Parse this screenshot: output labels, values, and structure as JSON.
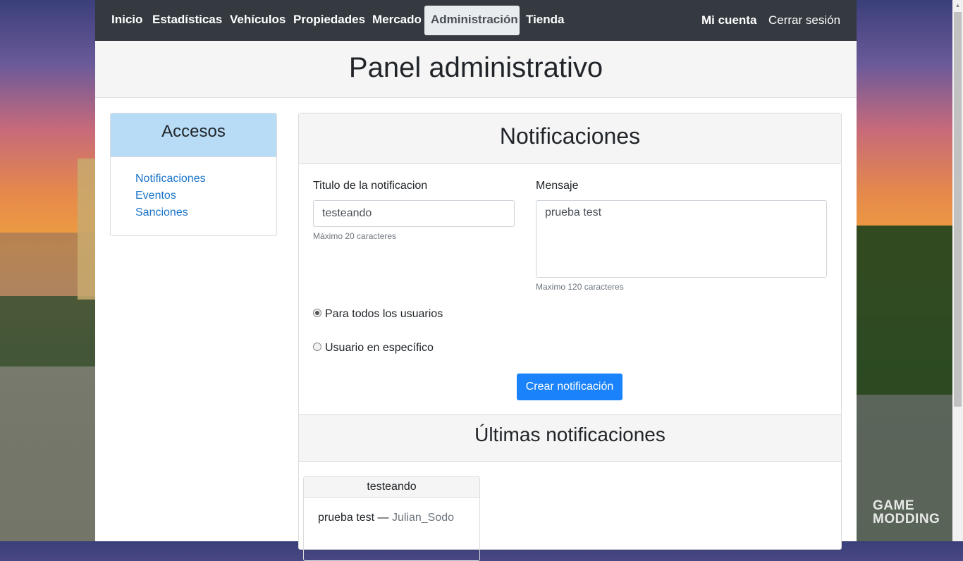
{
  "nav": {
    "items": [
      {
        "label": "Inicio"
      },
      {
        "label": "Estadísticas"
      },
      {
        "label": "Vehículos"
      },
      {
        "label": "Propiedades"
      },
      {
        "label": "Mercado"
      },
      {
        "label": "Administración"
      },
      {
        "label": "Tienda"
      }
    ],
    "active_index": 5,
    "account": "Mi cuenta",
    "logout": "Cerrar sesión"
  },
  "page": {
    "title": "Panel administrativo"
  },
  "sidebar": {
    "title": "Accesos",
    "links": [
      {
        "label": "Notificaciones"
      },
      {
        "label": "Eventos"
      },
      {
        "label": "Sanciones"
      }
    ]
  },
  "form": {
    "header": "Notificaciones",
    "title_label": "Titulo de la notificacion",
    "title_value": "testeando",
    "title_help": "Máximo 20 caracteres",
    "message_label": "Mensaje",
    "message_value": "prueba test",
    "message_help": "Maximo 120 caracteres",
    "radio_all": "Para todos los usuarios",
    "radio_specific": "Usuario en específico",
    "radio_selected": "all",
    "submit": "Crear notificación"
  },
  "latest": {
    "header": "Últimas notificaciones",
    "items": [
      {
        "title": "testeando",
        "message": "prueba test",
        "separator": "—",
        "author": "Julian_Sodo"
      }
    ]
  },
  "watermark": {
    "line1": "GAME",
    "line2": "MODDING"
  },
  "colors": {
    "navbar": "#343a40",
    "accent": "#1a82fb",
    "sidebar_header": "#b8dcf6",
    "link": "#1a73c9"
  }
}
